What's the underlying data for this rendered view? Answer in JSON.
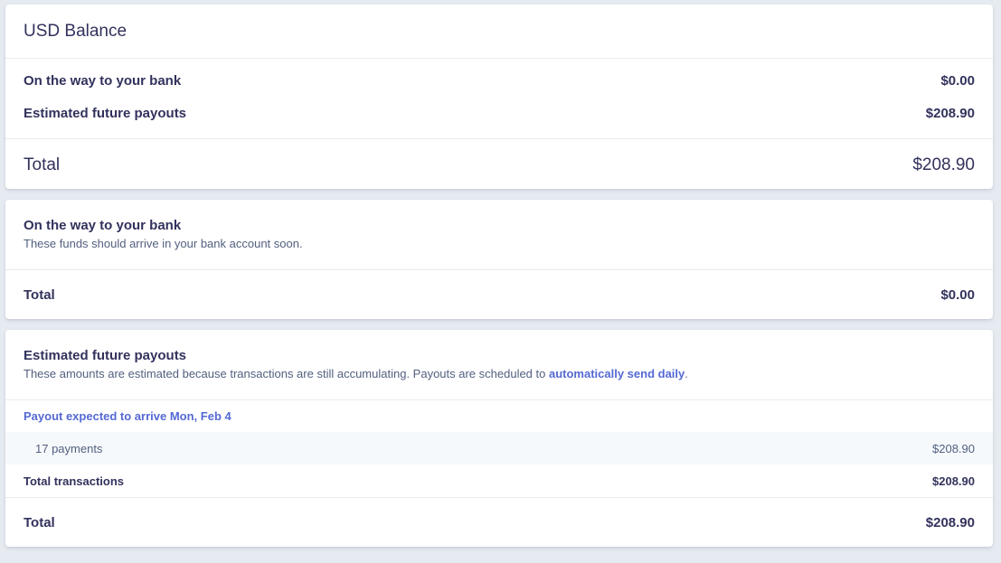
{
  "balance": {
    "title": "USD Balance",
    "on_the_way_label": "On the way to your bank",
    "on_the_way_value": "$0.00",
    "estimated_label": "Estimated future payouts",
    "estimated_value": "$208.90",
    "total_label": "Total",
    "total_value": "$208.90"
  },
  "on_the_way": {
    "title": "On the way to your bank",
    "description": "These funds should arrive in your bank account soon.",
    "total_label": "Total",
    "total_value": "$0.00"
  },
  "estimated": {
    "title": "Estimated future payouts",
    "description_prefix": "These amounts are estimated because transactions are still accumulating. Payouts are scheduled to ",
    "description_link": "automatically send daily",
    "description_suffix": ".",
    "payout_link": "Payout expected to arrive Mon, Feb 4",
    "payments_label": "17 payments",
    "payments_value": "$208.90",
    "transactions_label": "Total transactions",
    "transactions_value": "$208.90",
    "total_label": "Total",
    "total_value": "$208.90"
  },
  "colors": {
    "accent": "#5469d4",
    "background": "#e6ebf1",
    "text": "#32325d"
  }
}
